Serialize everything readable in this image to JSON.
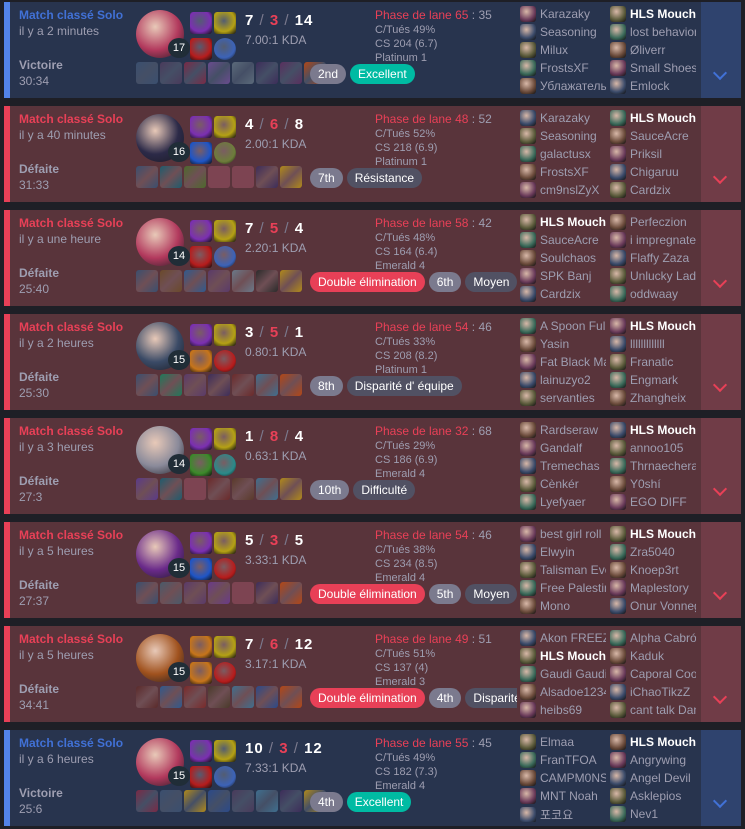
{
  "colors": {
    "win": "#5383e8",
    "loss": "#e84057",
    "badge_green": "#00bba3"
  },
  "icons": {
    "expand": "chevron-down-icon"
  },
  "games": [
    {
      "outcome": "win",
      "queue": "Match classé Solo",
      "ago": "il y a 2 minutes",
      "result": "Victoire",
      "duration": "30:34",
      "level": "17",
      "kills": "7",
      "deaths": "3",
      "assists": "14",
      "kda": "7.00:1 KDA",
      "lane": "Phase de lane 65",
      "lane_sub": "35",
      "kp": "C/Tués 49%",
      "cs": "CS 204 (6.7)",
      "rank": "Platinum 1",
      "badges": [
        {
          "label": "2nd",
          "kind": "rank"
        },
        {
          "label": "Excellent",
          "kind": "green"
        }
      ],
      "champ_color": "#b2395d",
      "spells": [
        "#7b2fb2",
        "#b71c1c",
        "#b5a114",
        "#3c63b8"
      ],
      "items": [
        "#3a4f6f",
        "#4a3a5b",
        "#7a2a46",
        "#6a4c8f",
        "#5b6a7a",
        "#3d2d5a",
        "#5a2f5e",
        "#b34716"
      ],
      "team1": [
        "Karazaky",
        "Seasoning",
        "Milux",
        "FrostsXF",
        "Ублажатель"
      ],
      "team2": [
        "HLS Mouche",
        "lost behavior",
        "Øliverr",
        "Small Shoes",
        "Emlock"
      ],
      "me": [
        1,
        0
      ]
    },
    {
      "outcome": "loss",
      "queue": "Match classé Solo",
      "ago": "il y a 40 minutes",
      "result": "Défaite",
      "duration": "31:33",
      "level": "16",
      "kills": "4",
      "deaths": "6",
      "assists": "8",
      "kda": "2.00:1 KDA",
      "lane": "Phase de lane 48",
      "lane_sub": "52",
      "kp": "C/Tués 52%",
      "cs": "CS 218 (6.9)",
      "rank": "Platinum 1",
      "badges": [
        {
          "label": "7th",
          "kind": "rank"
        },
        {
          "label": "Résistance",
          "kind": "tag"
        }
      ],
      "champ_color": "#2c2a48",
      "spells": [
        "#7b2fb2",
        "#1e55c7",
        "#b5a114",
        "#6d7d3a"
      ],
      "items": [
        "#3a4f6f",
        "#1f5c6e",
        "#4d6a2c",
        "",
        "",
        "#3d2d5a",
        "#b18a1a"
      ],
      "team1": [
        "Karazaky",
        "Seasoning",
        "galactusx",
        "FrostsXF",
        "cm9nslZyX"
      ],
      "team2": [
        "HLS Mouche",
        "SauceAcre",
        "Priksil",
        "Chigaruu",
        "Cardzix"
      ],
      "me": [
        1,
        0
      ]
    },
    {
      "outcome": "loss",
      "queue": "Match classé Solo",
      "ago": "il y a une heure",
      "result": "Défaite",
      "duration": "25:40",
      "level": "14",
      "kills": "7",
      "deaths": "5",
      "assists": "4",
      "kda": "2.20:1 KDA",
      "lane": "Phase de lane 58",
      "lane_sub": "42",
      "kp": "C/Tués 48%",
      "cs": "CS 164 (6.4)",
      "rank": "Emerald 4",
      "badges": [
        {
          "label": "Double élimination",
          "kind": "mvp"
        },
        {
          "label": "6th",
          "kind": "rank"
        },
        {
          "label": "Moyen",
          "kind": "tag"
        }
      ],
      "champ_color": "#b2395d",
      "spells": [
        "#7b2fb2",
        "#b71c1c",
        "#b5a114",
        "#3c63b8"
      ],
      "items": [
        "#3a4f6f",
        "#6b4a2a",
        "#2f5a8f",
        "#5a3a6a",
        "#6a7a8a",
        "#2b2b2b",
        "#b18a1a"
      ],
      "team1": [
        "HLS Mouche",
        "SauceAcre",
        "Soulchaos",
        "SPK Banj",
        "Cardzix"
      ],
      "team2": [
        "Perfeczion",
        "i impregnate",
        "Flaffy Zaza",
        "Unlucky Lad",
        "oddwaay"
      ],
      "me": [
        0,
        0
      ]
    },
    {
      "outcome": "loss",
      "queue": "Match classé Solo",
      "ago": "il y a 2 heures",
      "result": "Défaite",
      "duration": "25:30",
      "level": "15",
      "kills": "3",
      "deaths": "5",
      "assists": "1",
      "kda": "0.80:1 KDA",
      "lane": "Phase de lane 54",
      "lane_sub": "46",
      "kp": "C/Tués 33%",
      "cs": "CS 208 (8.2)",
      "rank": "Platinum 1",
      "badges": [
        {
          "label": "8th",
          "kind": "rank"
        },
        {
          "label": "Disparité d' équipe",
          "kind": "tag"
        }
      ],
      "champ_color": "#3a4a66",
      "spells": [
        "#7b2fb2",
        "#c7751a",
        "#b5a114",
        "#b71c1c"
      ],
      "items": [
        "#3a4f6f",
        "#1f7a5a",
        "#5a3a6a",
        "#3d2d5a",
        "#6b2a2a",
        "#3f6f8f",
        "#b34716"
      ],
      "team1": [
        "A Spoon Full",
        "Yasin",
        "Fat Black Man",
        "lainuzyo2",
        "servanties"
      ],
      "team2": [
        "HLS Mouche",
        "lllllllllllll",
        "Franatic",
        "Engmark",
        "Zhangheix"
      ],
      "me": [
        1,
        0
      ]
    },
    {
      "outcome": "loss",
      "queue": "Match classé Solo",
      "ago": "il y a 3 heures",
      "result": "Défaite",
      "duration": "27:3",
      "level": "14",
      "kills": "1",
      "deaths": "8",
      "assists": "4",
      "kda": "0.63:1 KDA",
      "lane": "Phase de lane 32",
      "lane_sub": "68",
      "kp": "C/Tués 29%",
      "cs": "CS 186 (6.9)",
      "rank": "Emerald 4",
      "badges": [
        {
          "label": "10th",
          "kind": "rank"
        },
        {
          "label": "Difficulté",
          "kind": "tag"
        }
      ],
      "champ_color": "#8a8a9a",
      "spells": [
        "#7b2fb2",
        "#3c8a2a",
        "#b5a114",
        "#2a8a8a"
      ],
      "items": [
        "#5a3a8a",
        "#1f5c6e",
        "",
        "#6b2a2a",
        "#5a3a2a",
        "#3f6f8f",
        "#b18a1a"
      ],
      "team1": [
        "Rardseraw",
        "Gandalf",
        "Tremechas",
        "Cènkér",
        "Lyefyaer"
      ],
      "team2": [
        "HLS Mouche",
        "annoo105",
        "Thrnaechera",
        "Y0shí",
        "EGO DIFF"
      ],
      "me": [
        1,
        0
      ]
    },
    {
      "outcome": "loss",
      "queue": "Match classé Solo",
      "ago": "il y a 5 heures",
      "result": "Défaite",
      "duration": "27:37",
      "level": "15",
      "kills": "5",
      "deaths": "3",
      "assists": "5",
      "kda": "3.33:1 KDA",
      "lane": "Phase de lane 54",
      "lane_sub": "46",
      "kp": "C/Tués 38%",
      "cs": "CS 234 (8.5)",
      "rank": "Emerald 4",
      "badges": [
        {
          "label": "Double élimination",
          "kind": "mvp"
        },
        {
          "label": "5th",
          "kind": "rank"
        },
        {
          "label": "Moyen",
          "kind": "tag"
        }
      ],
      "champ_color": "#6a2a8a",
      "spells": [
        "#7b2fb2",
        "#1e55c7",
        "#b5a114",
        "#b71c1c"
      ],
      "items": [
        "#3a4f6f",
        "#4a5a6a",
        "#5a3a6a",
        "#6a3a8a",
        "",
        "#3d2d5a",
        "#b34716"
      ],
      "team1": [
        "best girl roll",
        "Elwyin",
        "Talisman Eve",
        "Free Palestine",
        "Mono"
      ],
      "team2": [
        "HLS Mouche",
        "Zra5040",
        "Knoep3rt",
        "Maplestory",
        "Onur Vonnegut"
      ],
      "me": [
        1,
        0
      ]
    },
    {
      "outcome": "loss",
      "queue": "Match classé Solo",
      "ago": "il y a 5 heures",
      "result": "Défaite",
      "duration": "34:41",
      "level": "15",
      "kills": "7",
      "deaths": "6",
      "assists": "12",
      "kda": "3.17:1 KDA",
      "lane": "Phase de lane 49",
      "lane_sub": "51",
      "kp": "C/Tués 51%",
      "cs": "CS 137 (4)",
      "rank": "Emerald 3",
      "badges": [
        {
          "label": "Double élimination",
          "kind": "mvp"
        },
        {
          "label": "4th",
          "kind": "rank"
        },
        {
          "label": "Disparité d' équipe",
          "kind": "tag"
        }
      ],
      "champ_color": "#a0521e",
      "spells": [
        "#c7751a",
        "#c7751a",
        "#b5a114",
        "#b71c1c"
      ],
      "items": [
        "#5a2a2a",
        "#2f5a8f",
        "#7a2a2a",
        "#4a3a2a",
        "#3f6f8f",
        "#2b4a8a",
        "#b34716"
      ],
      "team1": [
        "Akon FREEZER",
        "HLS Mouche",
        "Gaudi Gaudi",
        "Alsadoe1234",
        "heibs69"
      ],
      "team2": [
        "Alpha Cabrón",
        "Kaduk",
        "Caporal Cookie",
        "iChaoTikzZ",
        "cant talk Dan"
      ],
      "me": [
        0,
        1
      ]
    },
    {
      "outcome": "win",
      "queue": "Match classé Solo",
      "ago": "il y a 6 heures",
      "result": "Victoire",
      "duration": "25:6",
      "level": "15",
      "kills": "10",
      "deaths": "3",
      "assists": "12",
      "kda": "7.33:1 KDA",
      "lane": "Phase de lane 55",
      "lane_sub": "45",
      "kp": "C/Tués 49%",
      "cs": "CS 182 (7.3)",
      "rank": "Emerald 4",
      "badges": [
        {
          "label": "4th",
          "kind": "rank"
        },
        {
          "label": "Excellent",
          "kind": "green"
        }
      ],
      "champ_color": "#b2395d",
      "spells": [
        "#7b2fb2",
        "#b71c1c",
        "#b5a114",
        "#3c63b8"
      ],
      "items": [
        "#7a2a46",
        "#3a4f6f",
        "#b18a1a",
        "#2b4a8a",
        "#4a3a5b",
        "#3f6f8f",
        "#3d2d5a",
        "#b18a1a"
      ],
      "team1": [
        "Elmaa",
        "FranTFOA",
        "CAMPM0NSTER",
        "MNT Noah",
        "포코요"
      ],
      "team2": [
        "HLS Mouche",
        "Angrywing",
        "Angel Devil",
        "Asklepios",
        "Nev1"
      ],
      "me": [
        1,
        0
      ]
    }
  ]
}
